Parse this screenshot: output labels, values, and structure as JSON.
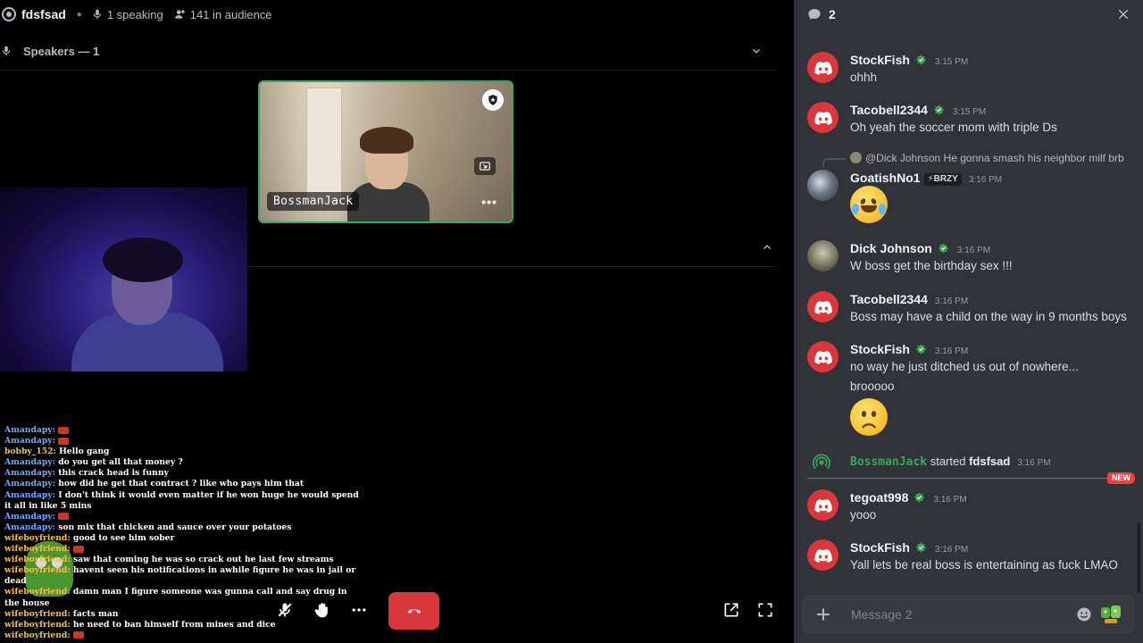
{
  "stage": {
    "channel_name": "fdsfsad",
    "speaking": "1 speaking",
    "audience": "141 in audience",
    "speakers_header": "Speakers — 1",
    "tile_name": "BossmanJack"
  },
  "stream_chat": [
    {
      "user": "Amandapy:",
      "text": "",
      "emote": true,
      "color": "blue"
    },
    {
      "user": "Amandapy:",
      "text": "",
      "emote": true,
      "color": "blue"
    },
    {
      "user": "bobby_152:",
      "text": "Hello gang",
      "color": "gold"
    },
    {
      "user": "Amandapy:",
      "text": "do you get all that money ?",
      "color": "blue"
    },
    {
      "user": "Amandapy:",
      "text": "this crack head is funny",
      "color": "blue"
    },
    {
      "user": "Amandapy:",
      "text": "how did he get that contract ? like who pays him that",
      "color": "blue"
    },
    {
      "user": "Amandapy:",
      "text": "I don't think it would even matter if he won huge he would spend it all in like 5 mins",
      "color": "blue"
    },
    {
      "user": "Amandapy:",
      "text": "",
      "emote": true,
      "color": "blue"
    },
    {
      "user": "Amandapy:",
      "text": "son mix that chicken and sauce over your potatoes",
      "color": "blue"
    },
    {
      "user": "wifeboyfriend:",
      "text": "good to see him sober",
      "color": "gold"
    },
    {
      "user": "wifeboyfriend:",
      "text": "",
      "emote": true,
      "color": "gold"
    },
    {
      "user": "wifeboyfriend:",
      "text": "saw that coming he was so crack out he last few streams",
      "color": "gold"
    },
    {
      "user": "wifeboyfriend:",
      "text": "havent seen his notifications in awhile figure he was in jail or dead",
      "color": "gold"
    },
    {
      "user": "wifeboyfriend:",
      "text": "damn man I figure someone was gunna call and say drug in the house",
      "color": "gold"
    },
    {
      "user": "wifeboyfriend:",
      "text": "facts man",
      "color": "gold"
    },
    {
      "user": "wifeboyfriend:",
      "text": "he need to ban himself from mines and dice",
      "color": "gold"
    },
    {
      "user": "wifeboyfriend:",
      "text": "",
      "emote": true,
      "color": "gold"
    }
  ],
  "panel": {
    "count": "2",
    "messages": [
      {
        "user": "StockFish",
        "time": "3:15 PM",
        "text": "ohhh"
      },
      {
        "user": "Tacobell2344",
        "time": "3:15 PM",
        "text": "Oh yeah the soccer mom with triple Ds"
      },
      {
        "reply": "@Dick Johnson He gonna smash his neighbor milf brb",
        "user": "GoatishNo1",
        "tag": "BRZY",
        "time": "3:16 PM"
      },
      {
        "user": "Dick Johnson",
        "time": "3:16 PM",
        "text": "W boss get the birthday sex !!!"
      },
      {
        "user": "Tacobell2344",
        "time": "3:16 PM",
        "text": "Boss may have a child on the way in 9 months boys"
      },
      {
        "user": "StockFish",
        "time": "3:16 PM",
        "text": "no way he just ditched us out of nowhere...",
        "text2": "brooooo"
      },
      {
        "user": "tegoat998",
        "time": "3:16 PM",
        "text": "yooo"
      },
      {
        "user": "StockFish",
        "time": "3:16 PM",
        "text": "Yall lets be real boss is entertaining as fuck LMAO"
      }
    ],
    "system": {
      "host": "BossmanJack",
      "action": "started",
      "channel": "fdsfsad",
      "time": "3:16 PM"
    },
    "new_label": "NEW",
    "composer_placeholder": "Message 2"
  },
  "colors": {
    "accent_green": "#3ba55d",
    "danger": "#da373c",
    "panel_bg": "#313338"
  }
}
